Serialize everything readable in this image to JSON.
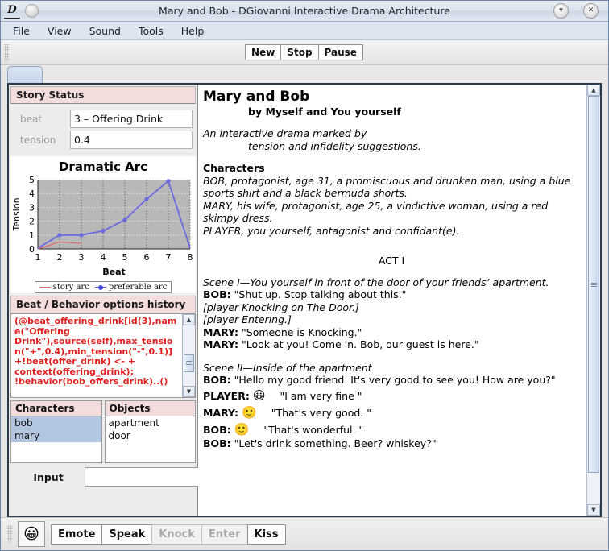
{
  "window": {
    "title": "Mary and Bob  -  DGiovanni Interactive Drama Architecture",
    "logo_text": "D",
    "minimize_icon": "▾",
    "close_icon": "✕"
  },
  "menubar": {
    "items": [
      "File",
      "View",
      "Sound",
      "Tools",
      "Help"
    ]
  },
  "toolbar": {
    "buttons": [
      "New",
      "Stop",
      "Pause"
    ]
  },
  "story_status": {
    "header": "Story Status",
    "fields": [
      {
        "label": "beat",
        "value": "3 – Offering Drink"
      },
      {
        "label": "tension",
        "value": "0.4"
      }
    ]
  },
  "chart_data": {
    "type": "line",
    "title": "Dramatic Arc",
    "xlabel": "Beat",
    "ylabel": "Tension",
    "x": [
      1,
      2,
      3,
      4,
      5,
      6,
      7,
      8
    ],
    "xticks": [
      "1",
      "2",
      "3",
      "4",
      "5",
      "6",
      "7",
      "8"
    ],
    "yticks": [
      "0",
      "1",
      "2",
      "3",
      "4",
      "5"
    ],
    "xlim": [
      1,
      8
    ],
    "ylim": [
      0,
      5
    ],
    "grid": true,
    "legend_position": "bottom",
    "plot_background": "#b8b8b8",
    "series": [
      {
        "name": "story arc",
        "color": "#e06a6a",
        "x": [
          1,
          2,
          3
        ],
        "values": [
          0.0,
          0.5,
          0.4
        ],
        "markers": false
      },
      {
        "name": "preferable arc",
        "color": "#6a6ae0",
        "x": [
          1,
          2,
          3,
          4,
          5,
          6,
          7,
          8
        ],
        "values": [
          0.05,
          1.0,
          1.0,
          1.3,
          2.1,
          3.6,
          4.9,
          0.05
        ],
        "markers": true
      }
    ]
  },
  "behavior_history": {
    "header": "Beat / Behavior options history",
    "text": "(@beat_offering_drink[id(3),name(\"Offering Drink\"),source(self),max_tension(\"+\",0.4),min_tension(\"-\",0.1)] +!beat(offer_drink) <- + context(offering_drink); !behavior(bob_offers_drink)..()",
    "scroll_up_icon": "▲",
    "scroll_down_icon": "▼"
  },
  "lists": {
    "characters": {
      "header": "Characters",
      "items": [
        "bob",
        "mary"
      ],
      "selected": [
        "bob",
        "mary"
      ]
    },
    "objects": {
      "header": "Objects",
      "items": [
        "apartment",
        "door"
      ],
      "selected": []
    }
  },
  "input": {
    "label": "Input",
    "value": "",
    "placeholder": ""
  },
  "story": {
    "title": "Mary and Bob",
    "byline": "by Myself and You yourself",
    "blurb_line1": "An interactive drama marked by",
    "blurb_line2": "tension and infidelity suggestions.",
    "characters_heading": "Characters",
    "characters": [
      "BOB,          protagonist, age 31, a promiscuous and drunken man, using a blue sports shirt and a black bermuda shorts.",
      "MARY,        his wife, protagonist, age 25, a vindictive woman, using a red skimpy dress.",
      "PLAYER,     you yourself, antagonist and confidant(e)."
    ],
    "act": "ACT I",
    "scene1_heading": "Scene I—You yourself in front of the door of your friends’ apartment.",
    "scene1_lines": [
      {
        "speaker": "BOB:",
        "text": " \"Shut up. Stop talking about this.\"",
        "stage": false
      },
      {
        "speaker": "",
        "text": "[player Knocking on The Door.]",
        "stage": true
      },
      {
        "speaker": "",
        "text": "[player Entering.]",
        "stage": true
      },
      {
        "speaker": "MARY:",
        "text": " \"Someone is Knocking.\"",
        "stage": false
      },
      {
        "speaker": "MARY:",
        "text": " \"Look at you! Come in. Bob, our guest is here.\"",
        "stage": false
      }
    ],
    "scene2_heading": "Scene II—Inside of the apartment",
    "scene2_lines": [
      {
        "speaker": "BOB:",
        "text": " \"Hello my good friend. It's very good to see you! How are you?\"",
        "emoji": ""
      },
      {
        "speaker": "PLAYER:",
        "text": "\"I am very fine \"",
        "emoji": "😀"
      },
      {
        "speaker": "MARY:",
        "text": "\"That's very good. \"",
        "emoji": "🙂"
      },
      {
        "speaker": "BOB:",
        "text": "\"That's wonderful. \"",
        "emoji": "🙂"
      },
      {
        "speaker": "BOB:",
        "text": " \"Let's drink something. Beer? whiskey?\"",
        "emoji": ""
      }
    ]
  },
  "bottom": {
    "emote_face": "😀",
    "buttons": [
      {
        "label": "Emote",
        "enabled": true
      },
      {
        "label": "Speak",
        "enabled": true
      },
      {
        "label": "Knock",
        "enabled": false
      },
      {
        "label": "Enter",
        "enabled": false
      },
      {
        "label": "Kiss",
        "enabled": true
      }
    ]
  }
}
